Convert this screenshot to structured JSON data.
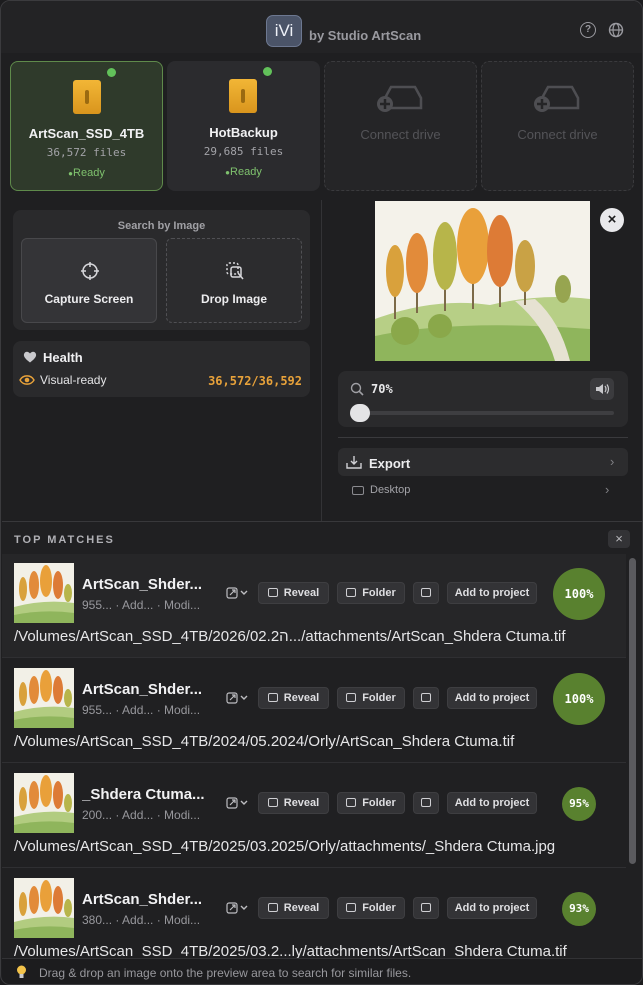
{
  "header": {
    "logo": "iVi",
    "byline": "by Studio ArtScan",
    "help_icon": "?",
    "globe_icon": "globe"
  },
  "drives": [
    {
      "name": "ArtScan_SSD_4TB",
      "files": "36,572 files",
      "status": "Ready",
      "selected": true
    },
    {
      "name": "HotBackup",
      "files": "29,685 files",
      "status": "Ready",
      "selected": false
    }
  ],
  "empty_slots": [
    {
      "label": "Connect drive"
    },
    {
      "label": "Connect drive"
    }
  ],
  "search": {
    "title": "Search by Image",
    "capture_label": "Capture Screen",
    "drop_label": "Drop Image"
  },
  "health": {
    "title": "Health",
    "visual_label": "Visual-ready",
    "visual_count": "36,572/36,592"
  },
  "preview": {
    "close": "×"
  },
  "zoom": {
    "value": "70%",
    "slider_fraction": 0.0
  },
  "export": {
    "label": "Export",
    "destination": "Desktop"
  },
  "matches": {
    "title": "TOP MATCHES",
    "close": "×",
    "reveal_label": "Reveal",
    "folder_label": "Folder",
    "add_label": "Add to project",
    "rows": [
      {
        "name": "ArtScan_Shder...",
        "meta": "955... · Add... · Modi...",
        "score": "100%",
        "path": "/Volumes/ArtScan_SSD_4TB/2026/02.2ה.../attachments/ArtScan_Shdera Ctuma.tif"
      },
      {
        "name": "ArtScan_Shder...",
        "meta": "955... · Add... · Modi...",
        "score": "100%",
        "path": "/Volumes/ArtScan_SSD_4TB/2024/05.2024/Orly/ArtScan_Shdera Ctuma.tif"
      },
      {
        "name": "_Shdera Ctuma...",
        "meta": "200... · Add... · Modi...",
        "score": "95%",
        "path": "/Volumes/ArtScan_SSD_4TB/2025/03.2025/Orly/attachments/_Shdera Ctuma.jpg"
      },
      {
        "name": "ArtScan_Shder...",
        "meta": "380... · Add... · Modi...",
        "score": "93%",
        "path": "/Volumes/ArtScan_SSD_4TB/2025/03.2...ly/attachments/ArtScan_Shdera Ctuma.tif"
      }
    ]
  },
  "footer": {
    "hint": "Drag & drop an image onto the preview area to search for similar files."
  }
}
